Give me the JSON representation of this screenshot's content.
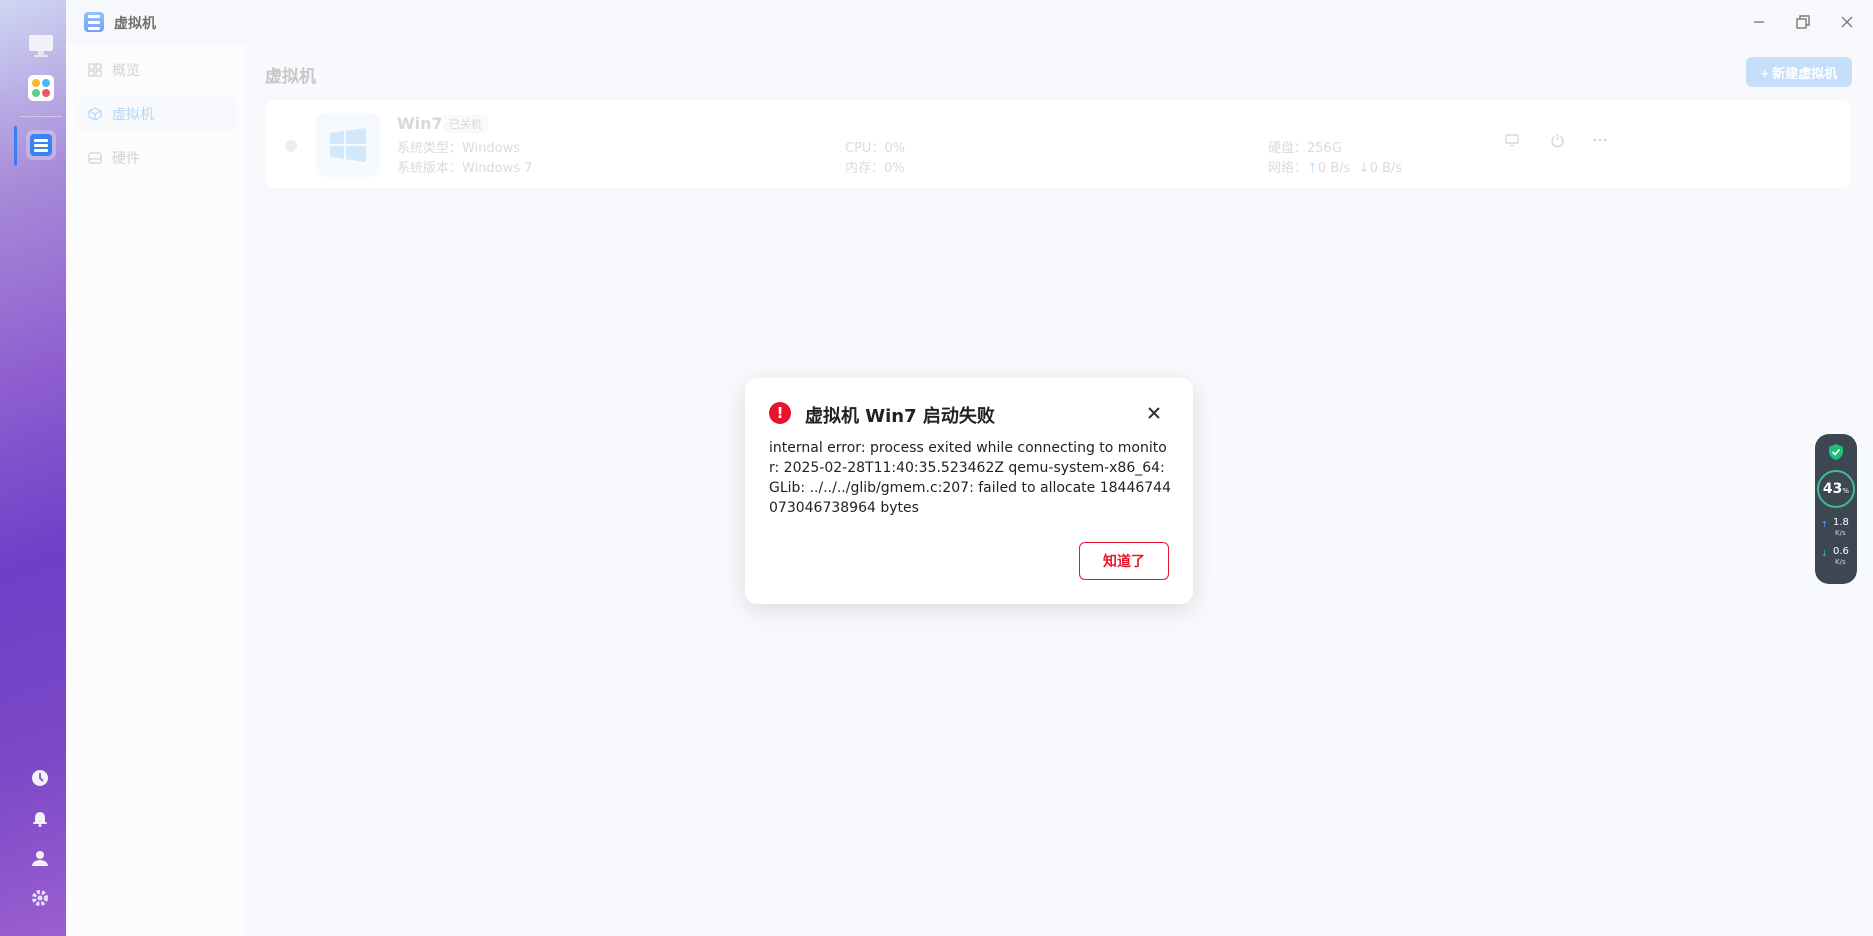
{
  "window": {
    "title": "虚拟机"
  },
  "sidebar": {
    "items": [
      {
        "label": "概览",
        "active": false,
        "icon": "grid-icon"
      },
      {
        "label": "虚拟机",
        "active": true,
        "icon": "cube-icon"
      },
      {
        "label": "硬件",
        "active": false,
        "icon": "drive-icon"
      }
    ]
  },
  "main": {
    "title": "虚拟机",
    "new_button": "+ 新建虚拟机",
    "vm": {
      "name": "Win7",
      "status": "已关机",
      "os_type_label": "系统类型：",
      "os_type": "Windows",
      "os_version_label": "系统版本：",
      "os_version": "Windows 7",
      "cpu_label": "CPU：",
      "cpu": "0%",
      "memory_label": "内存：",
      "memory": "0%",
      "disk_label": "硬盘：",
      "disk": "256G",
      "network_label": "网络：",
      "net_up": "0 B/s",
      "net_down": "0 B/s"
    }
  },
  "dialog": {
    "title": "虚拟机 Win7 启动失败",
    "message": "internal error: process exited while connecting to monitor: 2025-02-28T11:40:35.523462Z qemu-system-x86_64: GLib: ../../../glib/gmem.c:207: failed to allocate 18446744073046738964 bytes",
    "confirm": "知道了",
    "accent": "#e8162c"
  },
  "monitor": {
    "cpu_percent": "43",
    "percent_sign": "%",
    "upload": "1.8",
    "download": "0.6",
    "unit": "K/s"
  }
}
